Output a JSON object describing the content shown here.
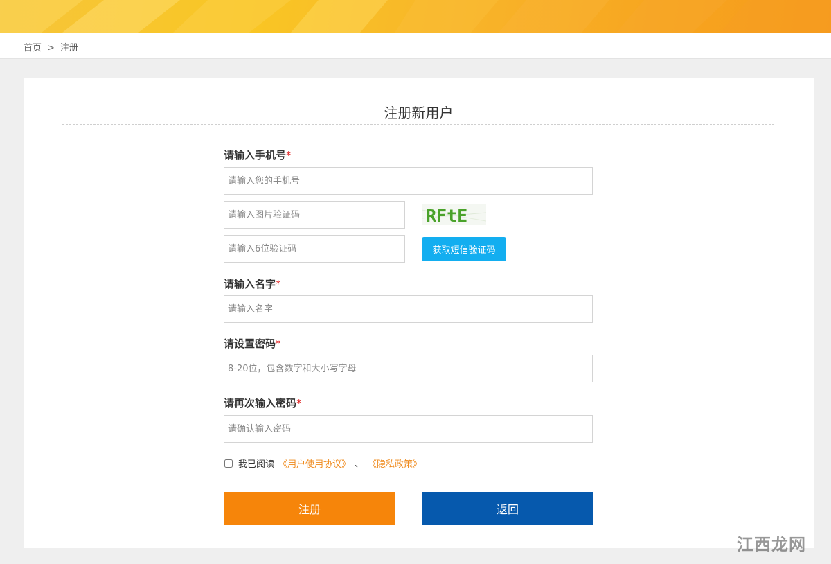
{
  "breadcrumb": {
    "home": "首页",
    "separator": ">",
    "current": "注册"
  },
  "page_title": "注册新用户",
  "phone": {
    "label": "请输入手机号",
    "required_mark": "*",
    "placeholder": "请输入您的手机号"
  },
  "image_captcha": {
    "placeholder": "请输入图片验证码",
    "captcha_text": "RFtE"
  },
  "sms_code": {
    "placeholder": "请输入6位验证码",
    "button_label": "获取短信验证码"
  },
  "name": {
    "label": "请输入名字",
    "required_mark": "*",
    "placeholder": "请输入名字"
  },
  "password": {
    "label": "请设置密码",
    "required_mark": "*",
    "placeholder": "8-20位，包含数字和大小写字母"
  },
  "confirm_password": {
    "label": "请再次输入密码",
    "required_mark": "*",
    "placeholder": "请确认输入密码"
  },
  "agreement": {
    "prefix": "我已阅读",
    "user_agreement": "《用户使用协议》",
    "separator": "、",
    "privacy_policy": "《隐私政策》"
  },
  "buttons": {
    "register": "注册",
    "back": "返回"
  },
  "watermark": "江西龙网",
  "colors": {
    "sms_button": "#13aef0",
    "register_button": "#f6850a",
    "back_button": "#0659ad",
    "link": "#ef8a1c",
    "required": "#e02020"
  }
}
